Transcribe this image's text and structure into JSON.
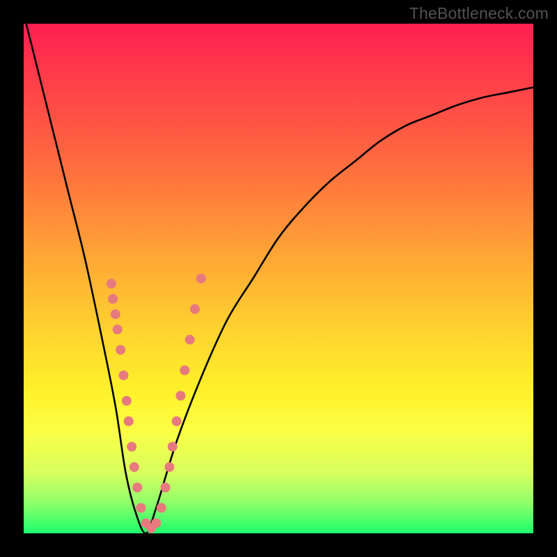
{
  "attribution": "TheBottleneck.com",
  "chart_data": {
    "type": "line",
    "title": "",
    "xlabel": "",
    "ylabel": "",
    "xlim": [
      0,
      1
    ],
    "ylim": [
      0,
      1
    ],
    "series": [
      {
        "name": "bottleneck-curve",
        "x": [
          0.0,
          0.03,
          0.06,
          0.09,
          0.12,
          0.15,
          0.18,
          0.2,
          0.22,
          0.24,
          0.26,
          0.3,
          0.35,
          0.4,
          0.45,
          0.5,
          0.55,
          0.6,
          0.65,
          0.7,
          0.75,
          0.8,
          0.85,
          0.9,
          0.95,
          1.0
        ],
        "y": [
          1.02,
          0.9,
          0.78,
          0.66,
          0.54,
          0.4,
          0.25,
          0.12,
          0.04,
          0.0,
          0.05,
          0.18,
          0.31,
          0.42,
          0.5,
          0.58,
          0.64,
          0.69,
          0.73,
          0.77,
          0.8,
          0.82,
          0.84,
          0.855,
          0.865,
          0.875
        ]
      }
    ],
    "beads": {
      "name": "data-points",
      "points_xy": [
        [
          0.172,
          0.49
        ],
        [
          0.175,
          0.46
        ],
        [
          0.18,
          0.43
        ],
        [
          0.184,
          0.4
        ],
        [
          0.19,
          0.36
        ],
        [
          0.196,
          0.31
        ],
        [
          0.202,
          0.26
        ],
        [
          0.206,
          0.22
        ],
        [
          0.212,
          0.17
        ],
        [
          0.217,
          0.13
        ],
        [
          0.223,
          0.09
        ],
        [
          0.23,
          0.05
        ],
        [
          0.24,
          0.02
        ],
        [
          0.25,
          0.01
        ],
        [
          0.26,
          0.02
        ],
        [
          0.27,
          0.05
        ],
        [
          0.278,
          0.09
        ],
        [
          0.286,
          0.13
        ],
        [
          0.292,
          0.17
        ],
        [
          0.3,
          0.22
        ],
        [
          0.308,
          0.27
        ],
        [
          0.316,
          0.32
        ],
        [
          0.326,
          0.38
        ],
        [
          0.336,
          0.44
        ],
        [
          0.348,
          0.5
        ]
      ],
      "radius": 7
    },
    "gradient_bands": [
      {
        "pos": 0.0,
        "color": "#ff1f52"
      },
      {
        "pos": 0.45,
        "color": "#ffa436"
      },
      {
        "pos": 0.72,
        "color": "#fff12a"
      },
      {
        "pos": 1.0,
        "color": "#1cff6d"
      }
    ]
  }
}
